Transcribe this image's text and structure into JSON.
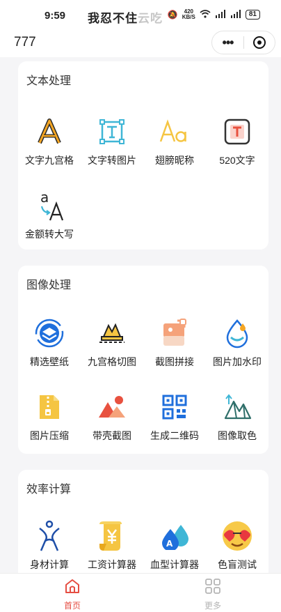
{
  "status_bar": {
    "time": "9:59",
    "ticker_text": "我忍不住",
    "ticker_faded": "云吃",
    "net_speed_value": "420",
    "net_speed_unit": "KB/S",
    "battery": "81"
  },
  "nav": {
    "title": "777",
    "more_label": "•••"
  },
  "sections": [
    {
      "title": "文本处理",
      "tools": [
        {
          "label": "文字九宫格",
          "icon": "letter-a-icon"
        },
        {
          "label": "文字转图片",
          "icon": "text-frame-icon"
        },
        {
          "label": "翅膀昵称",
          "icon": "font-aa-icon"
        },
        {
          "label": "520文字",
          "icon": "t-box-icon"
        },
        {
          "label": "金额转大写",
          "icon": "case-convert-icon"
        }
      ]
    },
    {
      "title": "图像处理",
      "tools": [
        {
          "label": "精选壁纸",
          "icon": "layers-icon"
        },
        {
          "label": "九宫格切图",
          "icon": "crop-mountain-icon"
        },
        {
          "label": "截图拼接",
          "icon": "image-stitch-icon"
        },
        {
          "label": "图片加水印",
          "icon": "water-drop-icon"
        },
        {
          "label": "图片压缩",
          "icon": "zip-file-icon"
        },
        {
          "label": "带壳截图",
          "icon": "mountain-photo-icon"
        },
        {
          "label": "生成二维码",
          "icon": "qr-code-icon"
        },
        {
          "label": "图像取色",
          "icon": "color-picker-icon"
        }
      ]
    },
    {
      "title": "效率计算",
      "tools": [
        {
          "label": "身材计算",
          "icon": "body-figure-icon"
        },
        {
          "label": "工资计算器",
          "icon": "salary-scroll-icon"
        },
        {
          "label": "血型计算器",
          "icon": "blood-drops-icon"
        },
        {
          "label": "色盲测试",
          "icon": "sunglasses-emoji-icon"
        }
      ]
    }
  ],
  "tabbar": {
    "home_label": "首页",
    "more_label": "更多",
    "active_color": "#e54d42",
    "inactive_color": "#b5b5b5"
  },
  "colors": {
    "orange": "#f5a623",
    "teal": "#3fb6d6",
    "blue": "#1f6fdc",
    "red_accent": "#e8513f"
  }
}
